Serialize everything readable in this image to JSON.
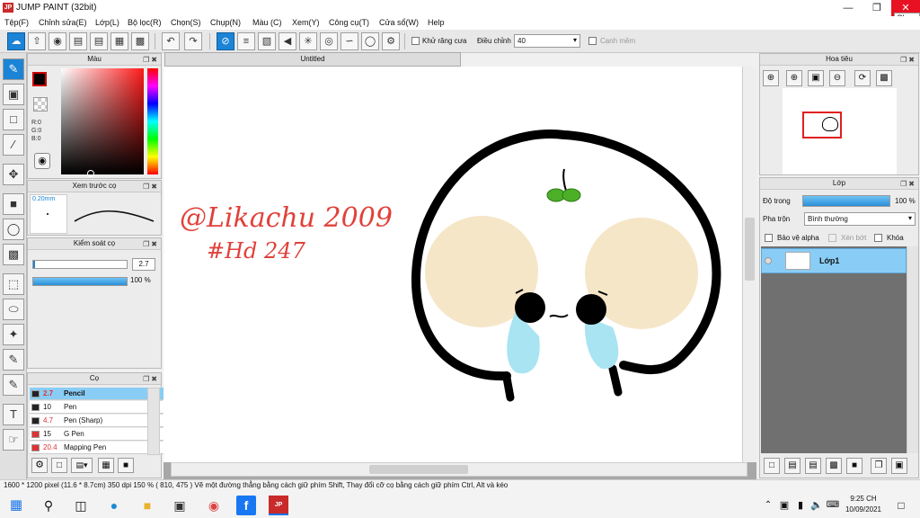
{
  "window": {
    "title": "JUMP PAINT (32bit)",
    "app_icon": "JP",
    "close_tooltip": "Close"
  },
  "menu": [
    "Tệp(F)",
    "Chỉnh sửa(E)",
    "Lớp(L)",
    "Bộ lọc(R)",
    "Chọn(S)",
    "Chụp(N)",
    "Màu (C)",
    "Xem(Y)",
    "Công cụ(T)",
    "Cửa sổ(W)",
    "Help"
  ],
  "toolbar": {
    "antialias_label": "Khử răng cưa",
    "adjust_label": "Điều chỉnh",
    "adjust_value": "40",
    "smooth_label": "Cạnh mềm"
  },
  "color_panel": {
    "title": "Màu",
    "r": "R:0",
    "g": "G:0",
    "b": "B:0"
  },
  "brush_preview": {
    "title": "Xem trước cọ",
    "size_label": "0.20mm"
  },
  "brush_control": {
    "title": "Kiểm soát cọ",
    "size_value": "2.7",
    "opacity_value": "100 %"
  },
  "brush_panel": {
    "title": "Cọ",
    "items": [
      {
        "size": "2.7",
        "name": "Pencil",
        "selected": true
      },
      {
        "size": "10",
        "name": "Pen"
      },
      {
        "size": "4.7",
        "name": "Pen (Sharp)"
      },
      {
        "size": "15",
        "name": "G Pen"
      },
      {
        "size": "20.4",
        "name": "Mapping Pen"
      }
    ]
  },
  "canvas": {
    "tab_title": "Untitled",
    "handwriting_line1": "@Likachu 2009",
    "handwriting_line2": "#Hd 247"
  },
  "navigator": {
    "title": "Hoa tiêu"
  },
  "layers": {
    "title": "Lớp",
    "opacity_label": "Độ trong",
    "opacity_value": "100 %",
    "blend_label": "Pha trộn",
    "blend_value": "Bình thường",
    "protect_alpha_label": "Bảo vệ alpha",
    "clip_label": "Xén bớt",
    "lock_label": "Khóa",
    "layer_name": "Lớp1"
  },
  "status": {
    "text": "1600 * 1200 pixel   (11.6 * 8.7cm)   350 dpi   150 %   ( 810, 475 )   Vẽ một đường thẳng bằng cách giữ phím Shift, Thay đổi cỡ cọ bằng cách giữ phím Ctrl, Alt và kéo"
  },
  "taskbar": {
    "time": "9:25 CH",
    "date": "10/09/2021"
  },
  "colors": {
    "accent": "#1b84d6",
    "layer_selected": "#89cdf6",
    "cheek": "#f6e6c8",
    "tear": "#a8e4f2",
    "leaf": "#4caf28",
    "handwriting": "#e0413a"
  }
}
